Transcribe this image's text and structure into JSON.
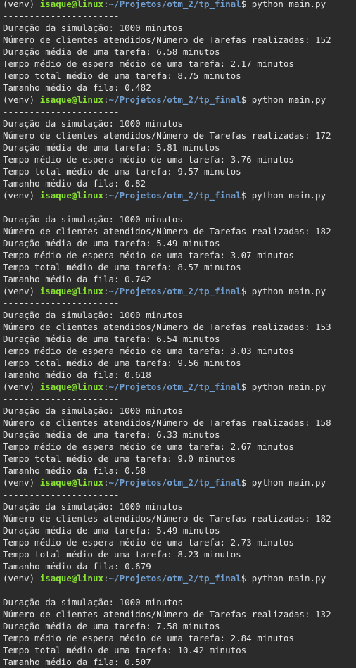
{
  "prompt": {
    "venv": "(venv) ",
    "user": "isaque@linux",
    "sep": ":",
    "path": "~/Projetos/otm_2/tp_final",
    "dollar": "$ ",
    "command": "python main.py"
  },
  "runs": [
    {
      "separator": "----------------------",
      "duration": "Duração da simulação: 1000 minutos",
      "clients": "Número de clientes atendidos/Número de Tarefas realizadas: 152",
      "avg_task": "Duração média de uma tarefa: 6.58 minutos",
      "avg_wait": "Tempo médio de espera médio de uma tarefa: 2.17 minutos",
      "avg_total": "Tempo total médio de uma tarefa: 8.75 minutos",
      "queue": "Tamanho médio da fila: 0.482"
    },
    {
      "separator": "----------------------",
      "duration": "Duração da simulação: 1000 minutos",
      "clients": "Número de clientes atendidos/Número de Tarefas realizadas: 172",
      "avg_task": "Duração média de uma tarefa: 5.81 minutos",
      "avg_wait": "Tempo médio de espera médio de uma tarefa: 3.76 minutos",
      "avg_total": "Tempo total médio de uma tarefa: 9.57 minutos",
      "queue": "Tamanho médio da fila: 0.82"
    },
    {
      "separator": "----------------------",
      "duration": "Duração da simulação: 1000 minutos",
      "clients": "Número de clientes atendidos/Número de Tarefas realizadas: 182",
      "avg_task": "Duração média de uma tarefa: 5.49 minutos",
      "avg_wait": "Tempo médio de espera médio de uma tarefa: 3.07 minutos",
      "avg_total": "Tempo total médio de uma tarefa: 8.57 minutos",
      "queue": "Tamanho médio da fila: 0.742"
    },
    {
      "separator": "----------------------",
      "duration": "Duração da simulação: 1000 minutos",
      "clients": "Número de clientes atendidos/Número de Tarefas realizadas: 153",
      "avg_task": "Duração média de uma tarefa: 6.54 minutos",
      "avg_wait": "Tempo médio de espera médio de uma tarefa: 3.03 minutos",
      "avg_total": "Tempo total médio de uma tarefa: 9.56 minutos",
      "queue": "Tamanho médio da fila: 0.618"
    },
    {
      "separator": "----------------------",
      "duration": "Duração da simulação: 1000 minutos",
      "clients": "Número de clientes atendidos/Número de Tarefas realizadas: 158",
      "avg_task": "Duração média de uma tarefa: 6.33 minutos",
      "avg_wait": "Tempo médio de espera médio de uma tarefa: 2.67 minutos",
      "avg_total": "Tempo total médio de uma tarefa: 9.0 minutos",
      "queue": "Tamanho médio da fila: 0.58"
    },
    {
      "separator": "----------------------",
      "duration": "Duração da simulação: 1000 minutos",
      "clients": "Número de clientes atendidos/Número de Tarefas realizadas: 182",
      "avg_task": "Duração média de uma tarefa: 5.49 minutos",
      "avg_wait": "Tempo médio de espera médio de uma tarefa: 2.73 minutos",
      "avg_total": "Tempo total médio de uma tarefa: 8.23 minutos",
      "queue": "Tamanho médio da fila: 0.679"
    },
    {
      "separator": "----------------------",
      "duration": "Duração da simulação: 1000 minutos",
      "clients": "Número de clientes atendidos/Número de Tarefas realizadas: 132",
      "avg_task": "Duração média de uma tarefa: 7.58 minutos",
      "avg_wait": "Tempo médio de espera médio de uma tarefa: 2.84 minutos",
      "avg_total": "Tempo total médio de uma tarefa: 10.42 minutos",
      "queue": "Tamanho médio da fila: 0.507"
    }
  ],
  "colors": {
    "background": "#2b2b2b",
    "text": "#e6e6e6",
    "user": "#8ae234",
    "path": "#729fcf"
  }
}
